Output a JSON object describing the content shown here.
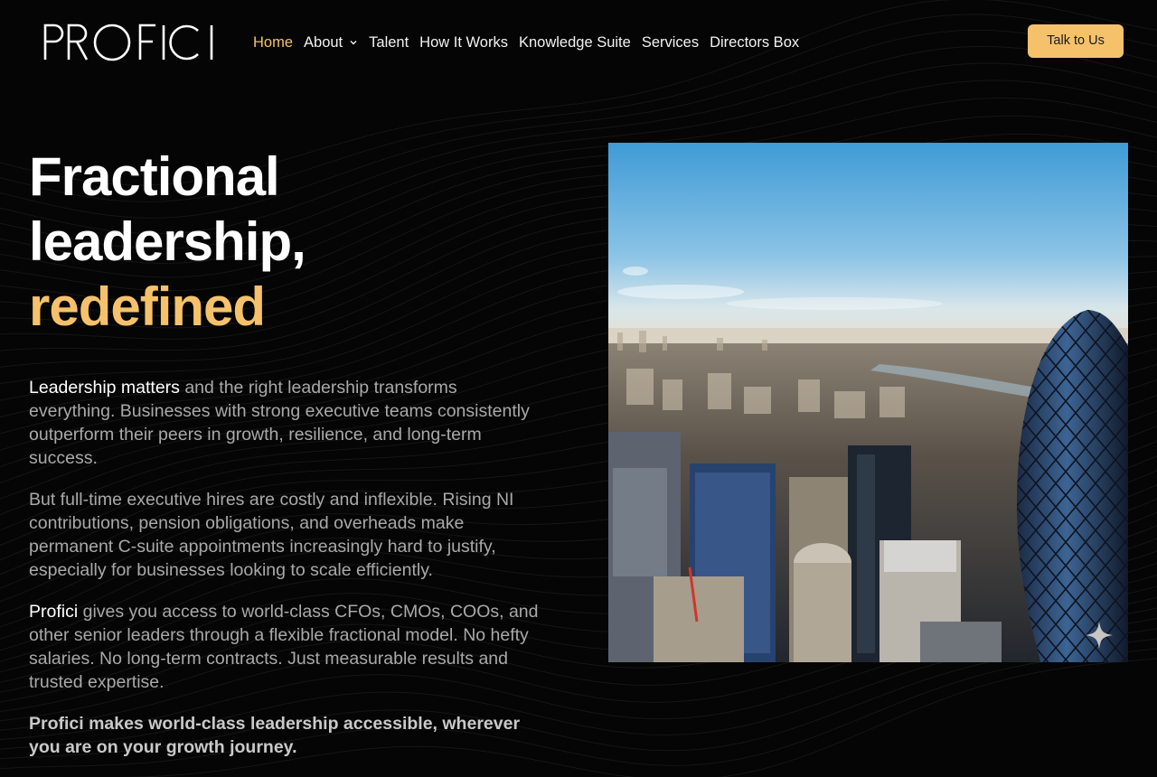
{
  "header": {
    "logo_text": "PROFICI",
    "nav": [
      {
        "label": "Home",
        "active": true
      },
      {
        "label": "About",
        "has_dropdown": true
      },
      {
        "label": "Talent"
      },
      {
        "label": "How It Works"
      },
      {
        "label": "Knowledge Suite"
      },
      {
        "label": "Services"
      },
      {
        "label": "Directors Box"
      }
    ],
    "cta_label": "Talk to Us"
  },
  "hero": {
    "title_line1": "Fractional",
    "title_line2": "leadership,",
    "title_line3": "redefined",
    "paragraph1": {
      "highlight": "Leadership matters",
      "rest": " and the right leadership transforms everything. Businesses with strong executive teams consistently outperform their peers in growth, resilience, and long-term success."
    },
    "paragraph2": "But full-time executive hires are costly and inflexible. Rising NI contributions, pension obligations, and overheads make permanent C-suite appointments increasingly hard to justify, especially for businesses looking to scale efficiently.",
    "paragraph3": {
      "highlight": "Profici",
      "rest": " gives you access to world-class CFOs, CMOs, COOs, and other senior leaders through a flexible fractional model. No hefty salaries. No long-term contracts. Just measurable results and trusted expertise."
    },
    "closing": "Profici makes world-class leadership accessible, wherever you are on your growth journey."
  },
  "image": {
    "icon": "sparkle-icon"
  },
  "colors": {
    "background": "#050505",
    "accent": "#f5c26b",
    "text_primary": "#ffffff",
    "text_muted": "#a9a9a9"
  }
}
